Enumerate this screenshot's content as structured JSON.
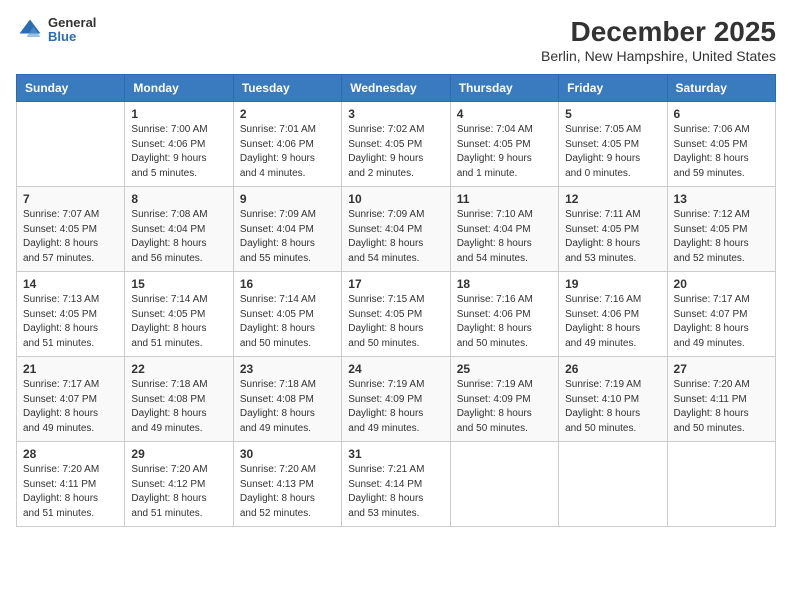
{
  "header": {
    "logo_general": "General",
    "logo_blue": "Blue",
    "title": "December 2025",
    "subtitle": "Berlin, New Hampshire, United States"
  },
  "calendar": {
    "days_of_week": [
      "Sunday",
      "Monday",
      "Tuesday",
      "Wednesday",
      "Thursday",
      "Friday",
      "Saturday"
    ],
    "weeks": [
      [
        {
          "day": "",
          "info": ""
        },
        {
          "day": "1",
          "info": "Sunrise: 7:00 AM\nSunset: 4:06 PM\nDaylight: 9 hours\nand 5 minutes."
        },
        {
          "day": "2",
          "info": "Sunrise: 7:01 AM\nSunset: 4:06 PM\nDaylight: 9 hours\nand 4 minutes."
        },
        {
          "day": "3",
          "info": "Sunrise: 7:02 AM\nSunset: 4:05 PM\nDaylight: 9 hours\nand 2 minutes."
        },
        {
          "day": "4",
          "info": "Sunrise: 7:04 AM\nSunset: 4:05 PM\nDaylight: 9 hours\nand 1 minute."
        },
        {
          "day": "5",
          "info": "Sunrise: 7:05 AM\nSunset: 4:05 PM\nDaylight: 9 hours\nand 0 minutes."
        },
        {
          "day": "6",
          "info": "Sunrise: 7:06 AM\nSunset: 4:05 PM\nDaylight: 8 hours\nand 59 minutes."
        }
      ],
      [
        {
          "day": "7",
          "info": "Sunrise: 7:07 AM\nSunset: 4:05 PM\nDaylight: 8 hours\nand 57 minutes."
        },
        {
          "day": "8",
          "info": "Sunrise: 7:08 AM\nSunset: 4:04 PM\nDaylight: 8 hours\nand 56 minutes."
        },
        {
          "day": "9",
          "info": "Sunrise: 7:09 AM\nSunset: 4:04 PM\nDaylight: 8 hours\nand 55 minutes."
        },
        {
          "day": "10",
          "info": "Sunrise: 7:09 AM\nSunset: 4:04 PM\nDaylight: 8 hours\nand 54 minutes."
        },
        {
          "day": "11",
          "info": "Sunrise: 7:10 AM\nSunset: 4:04 PM\nDaylight: 8 hours\nand 54 minutes."
        },
        {
          "day": "12",
          "info": "Sunrise: 7:11 AM\nSunset: 4:05 PM\nDaylight: 8 hours\nand 53 minutes."
        },
        {
          "day": "13",
          "info": "Sunrise: 7:12 AM\nSunset: 4:05 PM\nDaylight: 8 hours\nand 52 minutes."
        }
      ],
      [
        {
          "day": "14",
          "info": "Sunrise: 7:13 AM\nSunset: 4:05 PM\nDaylight: 8 hours\nand 51 minutes."
        },
        {
          "day": "15",
          "info": "Sunrise: 7:14 AM\nSunset: 4:05 PM\nDaylight: 8 hours\nand 51 minutes."
        },
        {
          "day": "16",
          "info": "Sunrise: 7:14 AM\nSunset: 4:05 PM\nDaylight: 8 hours\nand 50 minutes."
        },
        {
          "day": "17",
          "info": "Sunrise: 7:15 AM\nSunset: 4:05 PM\nDaylight: 8 hours\nand 50 minutes."
        },
        {
          "day": "18",
          "info": "Sunrise: 7:16 AM\nSunset: 4:06 PM\nDaylight: 8 hours\nand 50 minutes."
        },
        {
          "day": "19",
          "info": "Sunrise: 7:16 AM\nSunset: 4:06 PM\nDaylight: 8 hours\nand 49 minutes."
        },
        {
          "day": "20",
          "info": "Sunrise: 7:17 AM\nSunset: 4:07 PM\nDaylight: 8 hours\nand 49 minutes."
        }
      ],
      [
        {
          "day": "21",
          "info": "Sunrise: 7:17 AM\nSunset: 4:07 PM\nDaylight: 8 hours\nand 49 minutes."
        },
        {
          "day": "22",
          "info": "Sunrise: 7:18 AM\nSunset: 4:08 PM\nDaylight: 8 hours\nand 49 minutes."
        },
        {
          "day": "23",
          "info": "Sunrise: 7:18 AM\nSunset: 4:08 PM\nDaylight: 8 hours\nand 49 minutes."
        },
        {
          "day": "24",
          "info": "Sunrise: 7:19 AM\nSunset: 4:09 PM\nDaylight: 8 hours\nand 49 minutes."
        },
        {
          "day": "25",
          "info": "Sunrise: 7:19 AM\nSunset: 4:09 PM\nDaylight: 8 hours\nand 50 minutes."
        },
        {
          "day": "26",
          "info": "Sunrise: 7:19 AM\nSunset: 4:10 PM\nDaylight: 8 hours\nand 50 minutes."
        },
        {
          "day": "27",
          "info": "Sunrise: 7:20 AM\nSunset: 4:11 PM\nDaylight: 8 hours\nand 50 minutes."
        }
      ],
      [
        {
          "day": "28",
          "info": "Sunrise: 7:20 AM\nSunset: 4:11 PM\nDaylight: 8 hours\nand 51 minutes."
        },
        {
          "day": "29",
          "info": "Sunrise: 7:20 AM\nSunset: 4:12 PM\nDaylight: 8 hours\nand 51 minutes."
        },
        {
          "day": "30",
          "info": "Sunrise: 7:20 AM\nSunset: 4:13 PM\nDaylight: 8 hours\nand 52 minutes."
        },
        {
          "day": "31",
          "info": "Sunrise: 7:21 AM\nSunset: 4:14 PM\nDaylight: 8 hours\nand 53 minutes."
        },
        {
          "day": "",
          "info": ""
        },
        {
          "day": "",
          "info": ""
        },
        {
          "day": "",
          "info": ""
        }
      ]
    ]
  }
}
